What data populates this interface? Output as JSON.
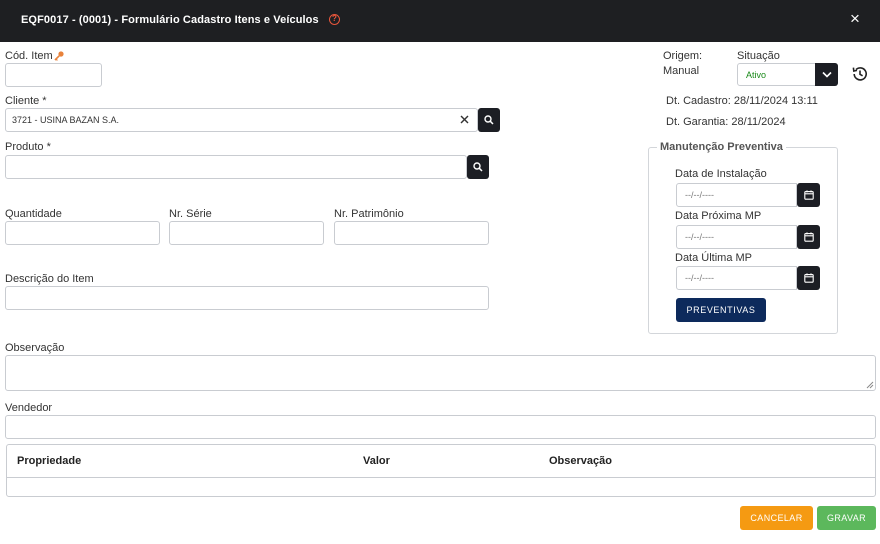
{
  "window": {
    "title": "EQF0017 - (0001) - Formulário Cadastro Itens e Veículos",
    "help_symbol": "?",
    "close_symbol": "×"
  },
  "form": {
    "cod_item": {
      "label": "Cód. Item",
      "value": ""
    },
    "cliente": {
      "label": "Cliente *",
      "value": "3721 - USINA BAZAN S.A."
    },
    "produto": {
      "label": "Produto *",
      "value": ""
    },
    "quantidade": {
      "label": "Quantidade",
      "value": ""
    },
    "nr_serie": {
      "label": "Nr. Série",
      "value": ""
    },
    "nr_patrimonio": {
      "label": "Nr. Patrimônio",
      "value": ""
    },
    "descricao": {
      "label": "Descrição do Item",
      "value": ""
    },
    "observacao": {
      "label": "Observação",
      "value": ""
    },
    "vendedor": {
      "label": "Vendedor",
      "value": ""
    }
  },
  "status": {
    "origem_label": "Origem:",
    "origem_value": "Manual",
    "situacao_label": "Situação",
    "situacao_value": "Ativo",
    "dt_cadastro": "Dt. Cadastro: 28/11/2024 13:11",
    "dt_garantia": "Dt. Garantia: 28/11/2024"
  },
  "manutencao": {
    "title": "Manutenção Preventiva",
    "data_instalacao": {
      "label": "Data de Instalação",
      "placeholder": "--/--/----"
    },
    "data_proxima": {
      "label": "Data Próxima MP",
      "placeholder": "--/--/----"
    },
    "data_ultima": {
      "label": "Data Última MP",
      "placeholder": "--/--/----"
    },
    "button": "PREVENTIVAS"
  },
  "grid": {
    "columns": [
      "Propriedade",
      "Valor",
      "Observação"
    ]
  },
  "actions": {
    "cancel": "CANCELAR",
    "save": "GRAVAR"
  },
  "colors": {
    "titlebar": "#1e1f22",
    "primary_dark": "#0d2a5c",
    "cancel": "#f59a12",
    "save": "#5cb85c",
    "help_icon": "#e8563b",
    "status_active": "#1a8a1a"
  },
  "icons": [
    "help-icon",
    "close-icon",
    "key-icon",
    "search-icon",
    "clear-icon",
    "calendar-icon",
    "chevron-down-icon",
    "history-icon"
  ]
}
